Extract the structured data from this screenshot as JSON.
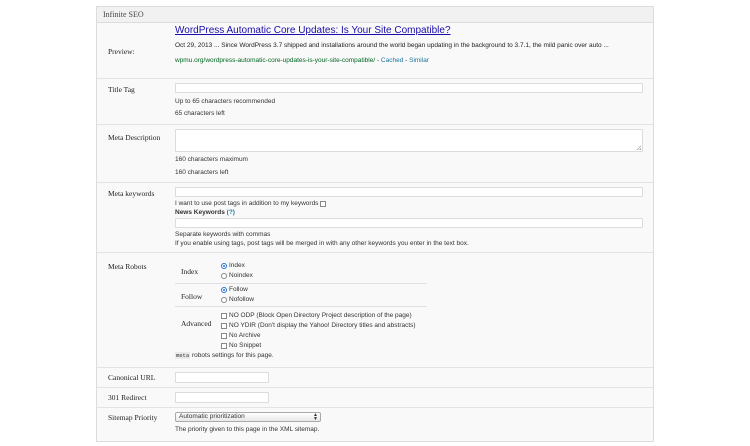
{
  "panel": {
    "title": "Infinite SEO"
  },
  "preview": {
    "label": "Preview:",
    "title": "WordPress Automatic Core Updates: Is Your Site Compatible?",
    "snippet": "Oct 29, 2013 ... Since WordPress 3.7 shipped and installations around the world began updating in the background to 3.7.1, the mild panic over auto ...",
    "url": "wpmu.org/wordpress-automatic-core-updates-is-your-site-compatible/",
    "sep1": " - ",
    "cached": "Cached",
    "sep2": " - ",
    "similar": "Similar"
  },
  "title_tag": {
    "label": "Title Tag",
    "value": "",
    "hint": "Up to 65 characters recommended",
    "count": "65 characters left"
  },
  "meta_description": {
    "label": "Meta Description",
    "value": "",
    "hint": "160 characters maximum",
    "count": "160 characters left"
  },
  "meta_keywords": {
    "label": "Meta keywords",
    "value": "",
    "post_tags_label": "I want to use post tags in addition to my keywords",
    "post_tags_checked": false,
    "news_label": "News Keywords",
    "news_help": "(?)",
    "news_value": "",
    "hint1": "Separate keywords with commas",
    "hint2": "If you enable using tags, post tags will be merged in with any other keywords you enter in the text box."
  },
  "meta_robots": {
    "label": "Meta Robots",
    "index": {
      "label": "Index",
      "options": [
        "Index",
        "Noindex"
      ],
      "selected": "Index"
    },
    "follow": {
      "label": "Follow",
      "options": [
        "Follow",
        "Nofollow"
      ],
      "selected": "Follow"
    },
    "advanced": {
      "label": "Advanced",
      "options": [
        "NO ODP (Block Open Directory Project description of the page)",
        "NO YDIR (Don't display the Yahoo! Directory titles and abstracts)",
        "No Archive",
        "No Snippet"
      ]
    },
    "note_code": "meta",
    "note_text": " robots settings for this page."
  },
  "canonical": {
    "label": "Canonical URL",
    "value": ""
  },
  "redirect": {
    "label": "301 Redirect",
    "value": ""
  },
  "sitemap": {
    "label": "Sitemap Priority",
    "selected": "Automatic prioritization",
    "hint": "The priority given to this page in the XML sitemap."
  }
}
